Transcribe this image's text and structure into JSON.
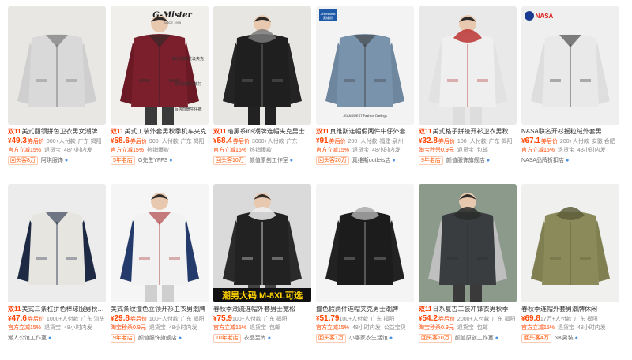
{
  "products": [
    {
      "title": "美式翻领拼色卫衣男女潮牌",
      "title_tag": "双11",
      "price": "49.3",
      "price_label": "券后价",
      "sold": "800+人付款",
      "location": "广东 揭阳",
      "perks": [
        "官方立减15%",
        "退货宝",
        "48小时内发"
      ],
      "shop_badge": "回头客8万",
      "shop": "阿琪服饰",
      "image_icon": "jacket-photo-gray-plaid"
    },
    {
      "title": "美式工装外套男秋季机车夹克",
      "title_tag": "双11",
      "price": "58.6",
      "price_label": "券后价",
      "sold": "900+人付款",
      "location": "广东 揭阳",
      "perks": [
        "官方立减15%",
        "热销爆款"
      ],
      "shop_badge": "5年老店",
      "shop": "G先生YFFS",
      "image_icon": "jacket-photo-burgundy",
      "image_text": {
        "brand": "G-Mister",
        "tagline": "SINCE 1995",
        "lines": [
          "美式潮牌垃圾夹克",
          "黑色长袖打底衫",
          "百搭直筒牛仔裤"
        ]
      }
    },
    {
      "title": "暗黑系ins潮牌连帽夹克男士",
      "title_tag": "双11",
      "price": "58.4",
      "price_label": "券后价",
      "sold": "3000+人付款",
      "location": "广东",
      "perks": [
        "官方立减15%",
        "热销爆款"
      ],
      "shop_badge": "回头客10万",
      "shop": "颜值原创工作室",
      "image_icon": "jacket-photo-black-hood"
    },
    {
      "title": "真维斯连帽假两件牛仔外套男士",
      "title_tag": "双11",
      "price": "91",
      "price_label": "券后价",
      "sold": "200+人付款",
      "location": "福建 泉州",
      "perks": [
        "官方立减15%",
        "退货宝",
        "48小时内发"
      ],
      "shop_badge": "回头客20万",
      "shop": "真维斯outlets店",
      "image_icon": "jacket-photo-denim",
      "image_text": {
        "brand": "Jeanswest",
        "brand_sub": "真维斯",
        "caption": "JEANSWEST Fashion Darlings"
      }
    },
    {
      "title": "美式格子拼接开衫卫衣男秋冬款",
      "title_tag": "双11",
      "price": "32.8",
      "price_label": "券后价",
      "sold": "100+人付款",
      "location": "广东 揭阳",
      "perks": [
        "淘宝秒杀0.9元",
        "退货宝",
        "包邮"
      ],
      "shop_badge": "9年老店",
      "shop": "颜值服饰旗舰店",
      "image_icon": "jacket-photo-white-hoodie"
    },
    {
      "title": "NASA联名开衫摇粒绒外套男",
      "title_tag": "",
      "price": "67.1",
      "price_label": "券后价",
      "sold": "200+人付款",
      "location": "安徽 合肥",
      "perks": [
        "官方立减15%",
        "退货宝",
        "48小时内发"
      ],
      "shop_badge": "",
      "shop": "NASA品牌折扣店",
      "image_icon": "jacket-photo-white-fleece",
      "image_text": {
        "brand": "NASA"
      }
    },
    {
      "title": "美式三条杠拼色棒球服男秋冬加厚",
      "title_tag": "双11",
      "price": "47.6",
      "price_label": "券后价",
      "sold": "1000+人付款",
      "location": "广东 汕头",
      "perks": [
        "官方立减15%",
        "退货宝",
        "48小时内发"
      ],
      "shop_badge": "",
      "shop": "潮人公馆工作室",
      "image_icon": "jacket-photo-varsity"
    },
    {
      "title": "美式条纹撞色立领开衫卫衣男潮牌",
      "title_tag": "",
      "price": "29.8",
      "price_label": "券后价",
      "sold": "100+人付款",
      "location": "广东 揭阳",
      "perks": [
        "淘宝秒杀0.9元",
        "退货宝",
        "48小时内发"
      ],
      "shop_badge": "9年老店",
      "shop": "颜值服饰旗舰店",
      "image_icon": "jacket-photo-stripe-zip"
    },
    {
      "title": "春秋季潮流连帽外套男士宽松",
      "title_tag": "",
      "price": "75.9",
      "price_label": "",
      "sold": "100+人付款",
      "location": "广东 揭阳",
      "perks": [
        "官方立减15%",
        "退货宝",
        "包邮"
      ],
      "shop_badge": "10年老店",
      "shop": "衣品至尚",
      "image_icon": "jacket-photo-black-parka",
      "image_text": {
        "banner": "潮男大码 M-8XL可选"
      }
    },
    {
      "title": "撞色假两件连帽夹克男士潮牌",
      "title_tag": "",
      "price": "51.79",
      "price_label": "",
      "sold": "100+人付款",
      "location": "广东 揭阳",
      "perks": [
        "官方立减15%",
        "48小时内发",
        "公益宝贝"
      ],
      "shop_badge": "回头客1万",
      "shop": "小娜家衣生活馆",
      "image_icon": "jacket-photo-black-hood-layer"
    },
    {
      "title": "日系复古工装冲锋衣男秋季",
      "title_tag": "双11",
      "price": "54.2",
      "price_label": "券后价",
      "sold": "2000+人付款",
      "location": "广东 揭阳",
      "perks": [
        "淘宝秒杀0.9元",
        "退货宝",
        "包邮"
      ],
      "shop_badge": "回头客10万",
      "shop": "颜值原创工作室",
      "image_icon": "jacket-photo-gray-windbreaker"
    },
    {
      "title": "春秋季连帽外套男潮牌休闲",
      "title_tag": "",
      "price": "69.8",
      "price_label": "",
      "sold": "17万+人付款",
      "location": "广东 揭阳",
      "perks": [
        "官方立减15%",
        "退货宝",
        "48小时内发"
      ],
      "shop_badge": "回头客4万",
      "shop": "NK男装",
      "image_icon": "jacket-photo-olive-hood"
    }
  ],
  "currency": "¥",
  "colors": {
    "price": "#ff4400",
    "accent": "#ff3c00",
    "muted": "#888888"
  }
}
